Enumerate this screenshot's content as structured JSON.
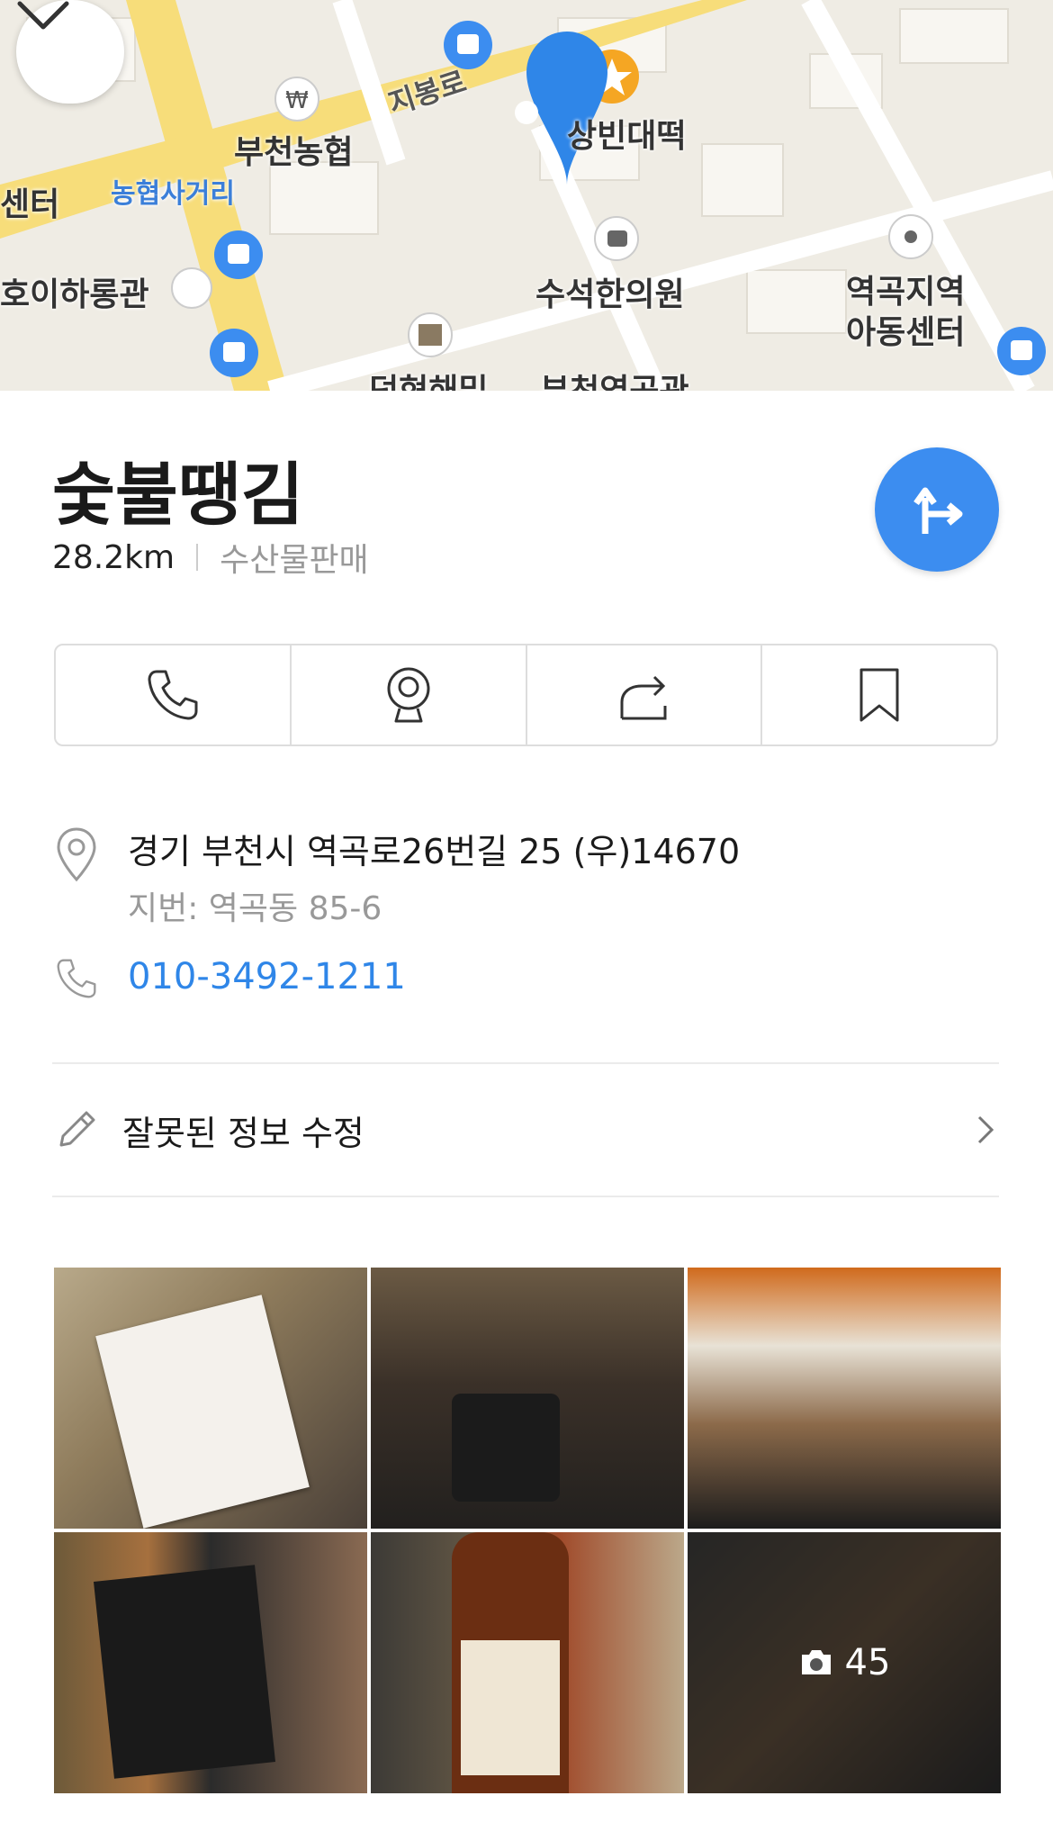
{
  "map": {
    "labels": {
      "nonghyup": "부천농협",
      "nonghyup_intersection": "농협사거리",
      "center": "센터",
      "hoi": "호이하롱관",
      "sangbin": "상빈대떡",
      "jibong_road": "지봉로",
      "suseok": "수석한의원",
      "yeokgok_center_1": "역곡지역",
      "yeokgok_center_2": "아동센터",
      "bottom_1": "덕현해밀",
      "bottom_2": "부천역곡관"
    },
    "colors": {
      "road": "#f7dd7a",
      "land": "#efece4",
      "marker": "#2f86e8",
      "bus": "#3c8df0"
    }
  },
  "place": {
    "name": "숯불땡김",
    "distance": "28.2km",
    "category": "수산물판매"
  },
  "actions": {
    "call_icon": "phone-icon",
    "roadview_icon": "roadview-icon",
    "share_icon": "share-icon",
    "save_icon": "bookmark-icon"
  },
  "info": {
    "address": "경기 부천시 역곡로26번길 25 (우)14670",
    "lot_address": "지번: 역곡동 85-6",
    "phone": "010-3492-1211"
  },
  "edit": {
    "label": "잘못된 정보 수정"
  },
  "photos": {
    "count": "45"
  }
}
